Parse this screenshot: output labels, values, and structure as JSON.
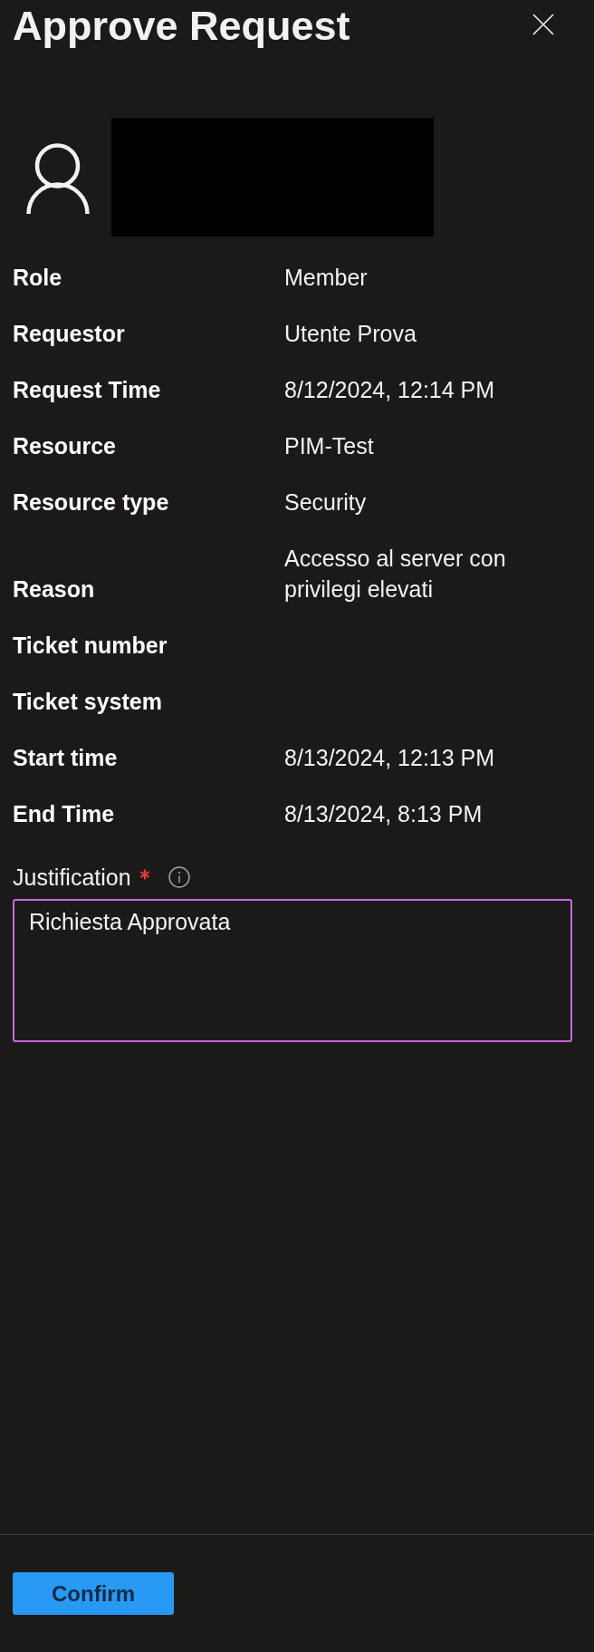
{
  "panel": {
    "title": "Approve Request"
  },
  "details": [
    {
      "label": "Role",
      "value": "Member"
    },
    {
      "label": "Requestor",
      "value": "Utente Prova"
    },
    {
      "label": "Request Time",
      "value": "8/12/2024, 12:14 PM"
    },
    {
      "label": "Resource",
      "value": "PIM-Test"
    },
    {
      "label": "Resource type",
      "value": "Security"
    },
    {
      "label": "Reason",
      "value": "Accesso al server con privilegi elevati"
    },
    {
      "label": "Ticket number"
    },
    {
      "label": "Ticket system"
    },
    {
      "label": "Start time",
      "value": "8/13/2024, 12:13 PM"
    },
    {
      "label": "End Time",
      "value": "8/13/2024, 8:13 PM"
    }
  ],
  "justification": {
    "label": "Justification",
    "required": true,
    "focused": true,
    "value": "Richiesta Approvata"
  },
  "actions": [
    {
      "label": "Confirm"
    }
  ]
}
